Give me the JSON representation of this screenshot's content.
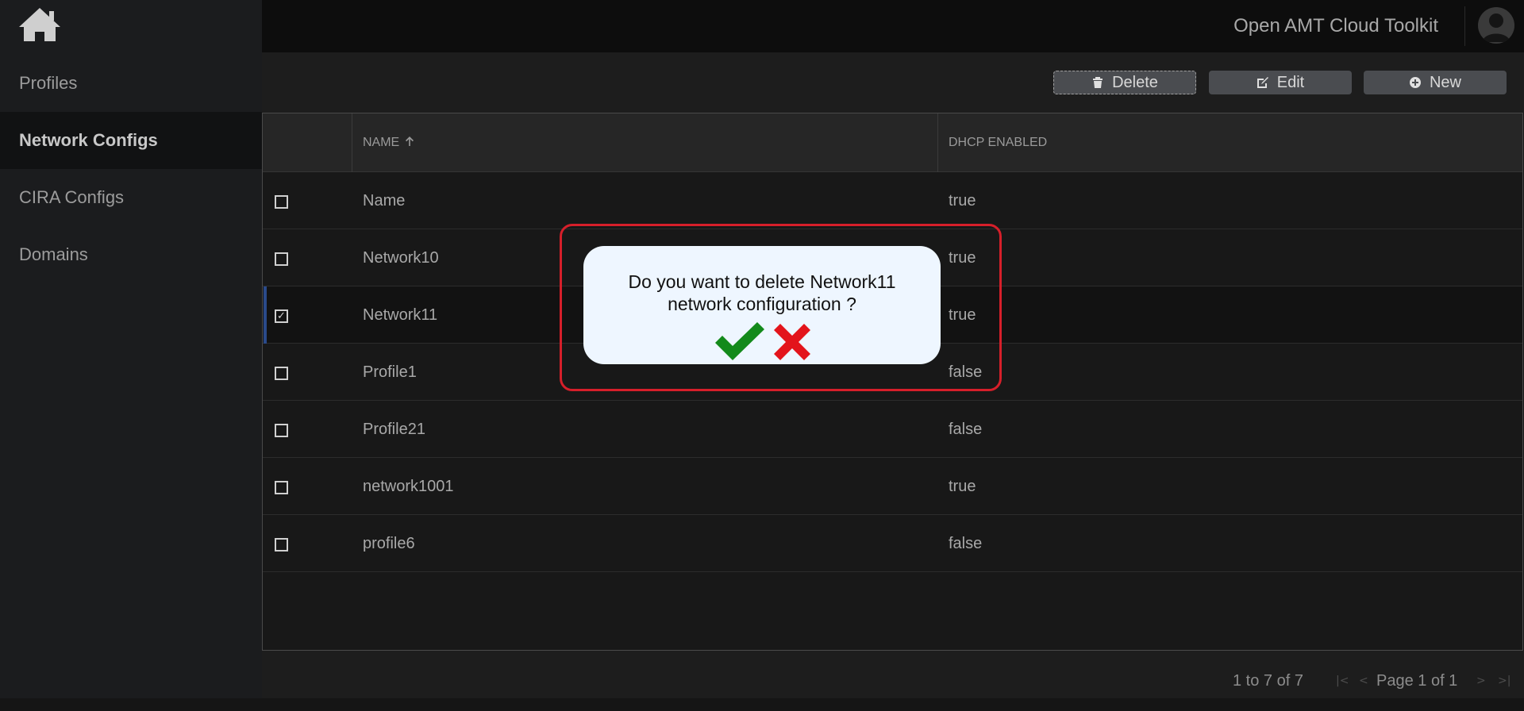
{
  "app": {
    "title": "Open AMT Cloud Toolkit"
  },
  "sidebar": {
    "items": [
      {
        "label": "Profiles",
        "active": false
      },
      {
        "label": "Network Configs",
        "active": true
      },
      {
        "label": "CIRA Configs",
        "active": false
      },
      {
        "label": "Domains",
        "active": false
      }
    ]
  },
  "toolbar": {
    "delete_label": "Delete",
    "edit_label": "Edit",
    "new_label": "New"
  },
  "table": {
    "columns": [
      "NAME",
      "DHCP ENABLED"
    ],
    "rows": [
      {
        "name": "Name",
        "dhcp": "true",
        "checked": false
      },
      {
        "name": "Network10",
        "dhcp": "true",
        "checked": false
      },
      {
        "name": "Network11",
        "dhcp": "true",
        "checked": true
      },
      {
        "name": "Profile1",
        "dhcp": "false",
        "checked": false
      },
      {
        "name": "Profile21",
        "dhcp": "false",
        "checked": false
      },
      {
        "name": "network1001",
        "dhcp": "true",
        "checked": false
      },
      {
        "name": "profile6",
        "dhcp": "false",
        "checked": false
      }
    ]
  },
  "pagination": {
    "range": "1 to 7 of 7",
    "page": "Page 1 of 1"
  },
  "dialog": {
    "line1": "Do you want to delete Network11",
    "line2": "network configuration ?"
  },
  "icons": {
    "home": "home-icon",
    "avatar": "user-icon",
    "delete": "trash-icon",
    "edit": "edit-icon",
    "new": "plus-circle-icon",
    "sort": "arrow-up-icon",
    "confirm": "check-icon",
    "cancel": "x-icon"
  },
  "colors": {
    "confirm": "#138a1b",
    "cancel": "#e3141b",
    "highlight": "#d61f2a"
  }
}
